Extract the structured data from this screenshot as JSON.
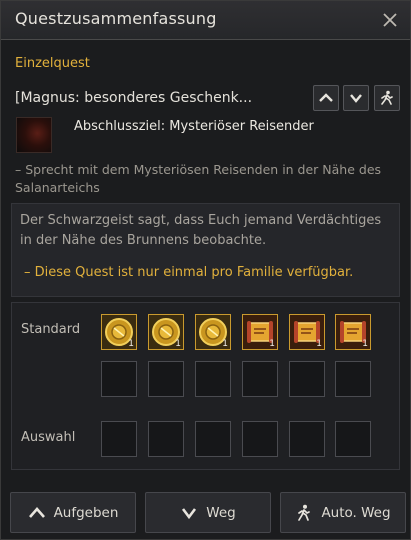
{
  "window": {
    "title": "Questzusammenfassung"
  },
  "quest": {
    "type": "Einzelquest",
    "name": "[Magnus: besonderes Geschenk...",
    "goal": "Abschlussziel: Mysteriöser Reisender",
    "hint": "– Sprecht mit dem Mysteriösen Reisenden in der Nähe des Salanarteichs",
    "description": "Der Schwarzgeist sagt, dass Euch jemand Verdächtiges in der Nähe des Brunnens beobachte.",
    "note": "– Diese Quest ist nur einmal pro Familie verfügbar."
  },
  "rewards": {
    "standard_label": "Standard",
    "auswahl_label": "Auswahl",
    "standard_items": [
      {
        "icon": "gold-coin-icon",
        "qty": "1"
      },
      {
        "icon": "gold-coin-icon",
        "qty": "1"
      },
      {
        "icon": "gold-coin-icon",
        "qty": "1"
      },
      {
        "icon": "scroll-icon",
        "qty": "1"
      },
      {
        "icon": "scroll-icon",
        "qty": "1"
      },
      {
        "icon": "scroll-icon",
        "qty": "1"
      }
    ]
  },
  "buttons": {
    "abandon": "Aufgeben",
    "path": "Weg",
    "auto_path": "Auto. Weg"
  },
  "colors": {
    "accent_gold": "#e2b13c",
    "background": "#1b1c1e"
  }
}
